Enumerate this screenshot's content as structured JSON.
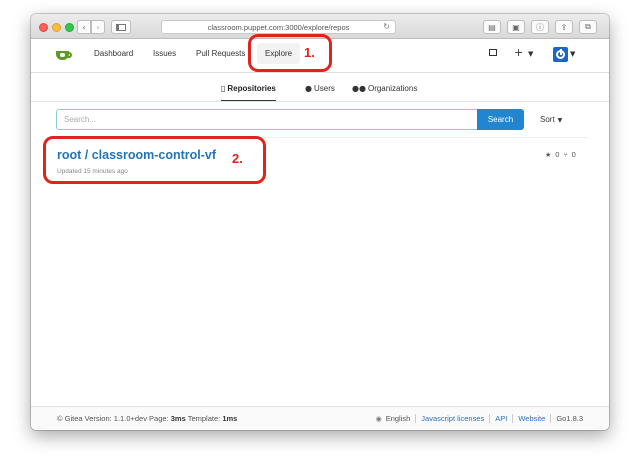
{
  "browser": {
    "url": "classroom.puppet.com:3000/explore/repos"
  },
  "navbar": {
    "dashboard": "Dashboard",
    "issues": "Issues",
    "pull_requests": "Pull Requests",
    "explore": "Explore"
  },
  "tabs": {
    "repositories": "Repositories",
    "users": "Users",
    "organizations": "Organizations"
  },
  "search": {
    "placeholder": "Search...",
    "button": "Search",
    "sort": "Sort"
  },
  "repos": [
    {
      "title": "root / classroom-control-vf",
      "updated": "Updated 15 minutes ago",
      "stars": "0",
      "forks": "0"
    }
  ],
  "annotations": {
    "label1": "1.",
    "label2": "2.",
    "color": "#e0231d"
  },
  "footer": {
    "version_prefix": "© Gitea Version: 1.1.0+dev Page: ",
    "page_time": "3ms",
    "template_prefix": " Template: ",
    "template_time": "1ms",
    "language": "English",
    "js_licenses": "Javascript licenses",
    "api": "API",
    "website": "Website",
    "go_version": "Go1.8.3"
  },
  "colors": {
    "accent": "#2185d0",
    "link": "#2474b8",
    "logo": "#609926",
    "avatar": "#1b67c9"
  },
  "icons": {
    "logo": "gitea-logo-icon",
    "repo": "repo-icon",
    "user": "user-icon",
    "org": "organization-icon",
    "star": "star-icon",
    "fork": "fork-icon",
    "globe": "globe-icon"
  }
}
